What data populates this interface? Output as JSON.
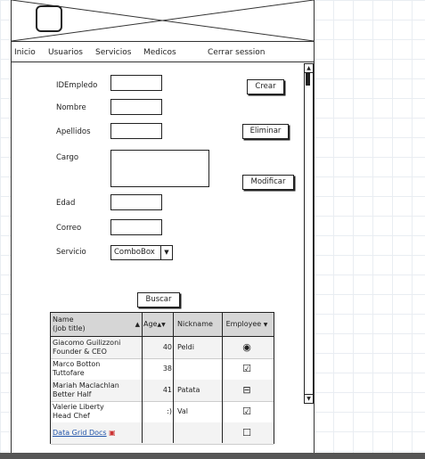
{
  "nav": {
    "items": [
      "Inicio",
      "Usuarios",
      "Servicios",
      "Medicos",
      "Cerrar session"
    ]
  },
  "form": {
    "id_label": "IDEmpledo",
    "nombre_label": "Nombre",
    "apellidos_label": "Apellidos",
    "cargo_label": "Cargo",
    "edad_label": "Edad",
    "correo_label": "Correo",
    "servicio_label": "Servicio",
    "servicio_value": "ComboBox"
  },
  "buttons": {
    "crear": "Crear",
    "eliminar": "Eliminar",
    "modificar": "Modificar",
    "buscar": "Buscar"
  },
  "grid": {
    "headers": {
      "name_line1": "Name",
      "name_line2": "(job title)",
      "age": "Age",
      "nickname": "Nickname",
      "employee": "Employee"
    },
    "rows": [
      {
        "name": "Giacomo Guilizzoni",
        "title": "Founder & CEO",
        "age": "40",
        "nickname": "Peldi",
        "employee": "radio-selected"
      },
      {
        "name": "Marco Botton",
        "title": "Tuttofare",
        "age": "38",
        "nickname": "",
        "employee": "checked"
      },
      {
        "name": "Mariah Maclachlan",
        "title": "Better Half",
        "age": "41",
        "nickname": "Patata",
        "employee": "indeterminate"
      },
      {
        "name": "Valerie Liberty",
        "title": "Head Chef",
        "age": ":)",
        "nickname": "Val",
        "employee": "checked"
      }
    ],
    "footer_link": "Data Grid Docs",
    "footer_employee": "unchecked"
  }
}
